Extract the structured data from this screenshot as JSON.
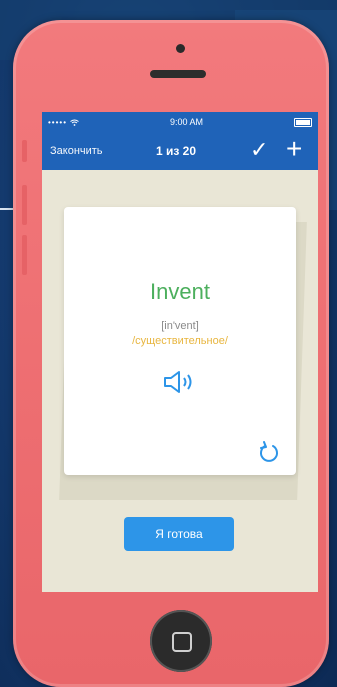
{
  "status_bar": {
    "signal": "•••••",
    "time": "9:00 AM"
  },
  "nav": {
    "finish_label": "Закончить",
    "counter": "1 из 20",
    "check_icon": "checkmark-icon",
    "add_icon": "plus-icon"
  },
  "card": {
    "word": "Invent",
    "transcription": "[in'vent]",
    "part_of_speech": "/существительное/",
    "audio_icon": "speaker-icon",
    "flip_icon": "reload-icon"
  },
  "ready_button_label": "Я готова",
  "colors": {
    "accent": "#1f63b8",
    "button": "#2d95e8",
    "word": "#4caf5d",
    "part_of_speech": "#e8b640",
    "phone": "#ee6f72"
  }
}
